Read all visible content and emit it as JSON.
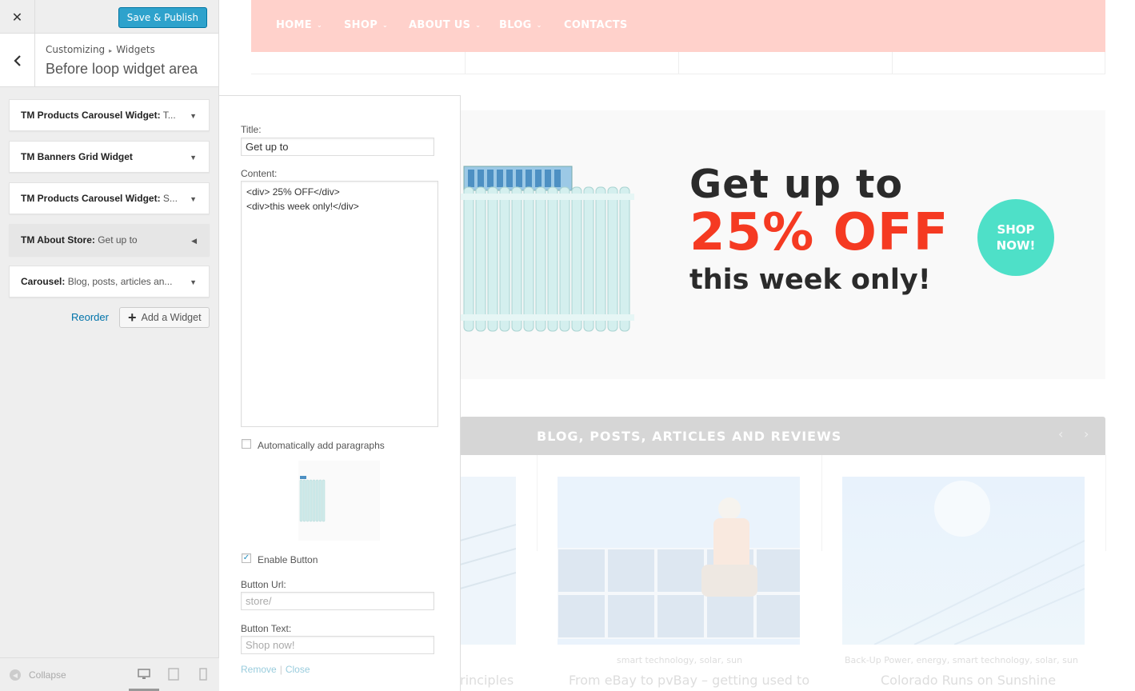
{
  "sidebar": {
    "close_icon": "close-icon",
    "save_label": "Save & Publish",
    "breadcrumb": {
      "root": "Customizing",
      "current": "Widgets"
    },
    "section_title": "Before loop widget area",
    "widgets": [
      {
        "title": "TM Products Carousel Widget:",
        "sub": " T...",
        "expanded": false
      },
      {
        "title": "TM Banners Grid Widget",
        "sub": "",
        "expanded": false
      },
      {
        "title": "TM Products Carousel Widget:",
        "sub": " S...",
        "expanded": false
      },
      {
        "title": "TM About Store:",
        "sub": " Get up to",
        "expanded": true
      },
      {
        "title": "Carousel:",
        "sub": " Blog, posts, articles an...",
        "expanded": false
      }
    ],
    "reorder_label": "Reorder",
    "add_widget_label": "Add a Widget",
    "collapse_label": "Collapse"
  },
  "widget_form": {
    "title_label": "Title:",
    "title_value": "Get up to",
    "content_label": "Content:",
    "content_value": "<div> 25% OFF</div>\n<div>this week only!</div>",
    "auto_paragraphs_label": "Automatically add paragraphs",
    "auto_paragraphs_checked": false,
    "enable_button_label": "Enable Button",
    "enable_button_checked": true,
    "button_url_label": "Button Url:",
    "button_url_value": "store/",
    "button_text_label": "Button Text:",
    "button_text_value": "Shop now!",
    "remove_label": "Remove",
    "separator": "|",
    "close_label": "Close"
  },
  "preview": {
    "nav": [
      "HOME",
      "SHOP",
      "ABOUT US",
      "BLOG",
      "CONTACTS"
    ],
    "banner": {
      "line1": "Get up to",
      "line2": "25% OFF",
      "line3": "this week only!",
      "button_line1": "SHOP",
      "button_line2": "NOW!"
    },
    "blog_title": "BLOG, POSTS, ARTICLES AND REVIEWS",
    "posts": [
      {
        "meta": "",
        "title": "rinciples"
      },
      {
        "meta": "smart technology, solar, sun",
        "title": "From eBay to pvBay – getting used to"
      },
      {
        "meta": "Back-Up Power, energy, smart technology, solar, sun",
        "title": "Colorado Runs on Sunshine"
      }
    ]
  },
  "colors": {
    "accent_blue": "#2ea2cc",
    "nav_pink": "#ffd1cb",
    "offer_red": "#f53a22",
    "shop_teal": "#4ee0c8"
  }
}
